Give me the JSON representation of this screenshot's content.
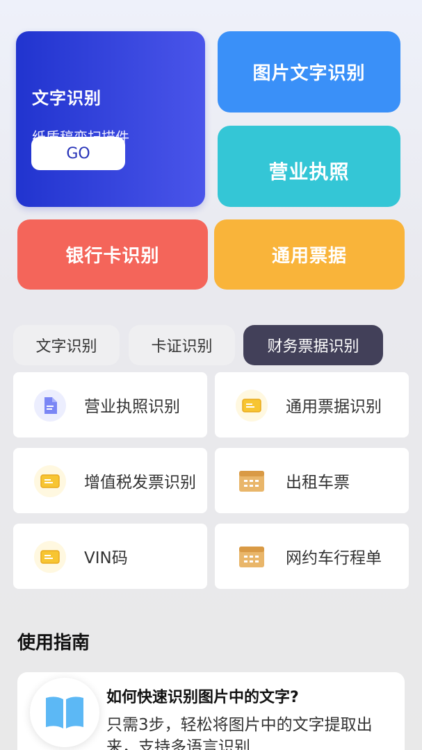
{
  "hero": {
    "title": "文字识别",
    "subtitle": "纸质稿变扫描件",
    "go_label": "GO"
  },
  "quick": {
    "image_text": "图片文字识别",
    "business_license": "营业执照",
    "bank_card": "银行卡识别",
    "general_bill": "通用票据"
  },
  "tabs": [
    {
      "label": "文字识别",
      "active": false
    },
    {
      "label": "卡证识别",
      "active": false
    },
    {
      "label": "财务票据识别",
      "active": true
    }
  ],
  "items": [
    {
      "label": "营业执照识别",
      "icon": "document-icon"
    },
    {
      "label": "通用票据识别",
      "icon": "ticket-icon"
    },
    {
      "label": "增值税发票识别",
      "icon": "ticket-icon"
    },
    {
      "label": "出租车票",
      "icon": "table-icon"
    },
    {
      "label": "VIN码",
      "icon": "ticket-icon"
    },
    {
      "label": "网约车行程单",
      "icon": "table-icon"
    }
  ],
  "guide": {
    "section_title": "使用指南",
    "question": "如何快速识别图片中的文字?",
    "answer": "只需3步，轻松将图片中的文字提取出来，支持多语言识别"
  },
  "colors": {
    "hero_start": "#2134cf",
    "hero_end": "#4a55ea",
    "image_text": "#3a90f8",
    "business_license": "#34c6d6",
    "bank_card": "#f4655a",
    "general_bill": "#f9b43a",
    "active_tab": "#424059"
  }
}
